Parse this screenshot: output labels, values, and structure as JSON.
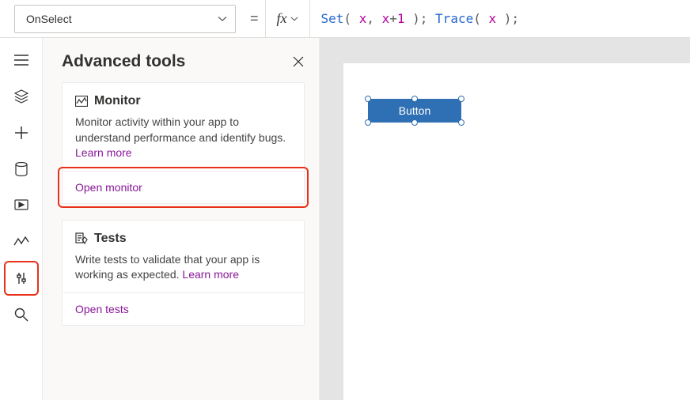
{
  "formula_bar": {
    "property": "OnSelect",
    "eq": "=",
    "fx_label": "fx",
    "expr_tokens": [
      {
        "t": "Set",
        "c": "fn"
      },
      {
        "t": "( ",
        "c": "punc"
      },
      {
        "t": "x",
        "c": "var"
      },
      {
        "t": ", ",
        "c": "punc"
      },
      {
        "t": "x",
        "c": "var"
      },
      {
        "t": "+",
        "c": "punc"
      },
      {
        "t": "1",
        "c": "num"
      },
      {
        "t": " ); ",
        "c": "punc"
      },
      {
        "t": "Trace",
        "c": "fn"
      },
      {
        "t": "( ",
        "c": "punc"
      },
      {
        "t": "x",
        "c": "var"
      },
      {
        "t": " );",
        "c": "punc"
      }
    ]
  },
  "rail": {
    "items": [
      "menu",
      "layers",
      "plus",
      "database",
      "media",
      "flow",
      "tools",
      "search"
    ]
  },
  "panel": {
    "title": "Advanced tools",
    "cards": [
      {
        "title": "Monitor",
        "desc": "Monitor activity within your app to understand performance and identify bugs. ",
        "learn": "Learn more",
        "action": "Open monitor"
      },
      {
        "title": "Tests",
        "desc": "Write tests to validate that your app is working as expected. ",
        "learn": "Learn more",
        "action": "Open tests"
      }
    ]
  },
  "canvas": {
    "button_label": "Button"
  }
}
